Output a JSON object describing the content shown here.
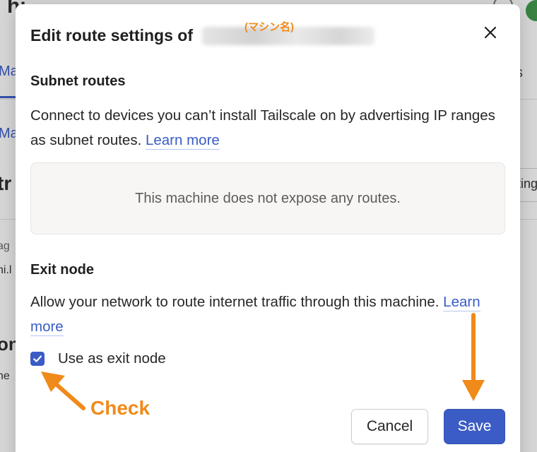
{
  "background": {
    "title_fragment": "hi ... @ ...",
    "tab_left_fragment": "Ma",
    "tab_right_fragment": "s",
    "sub_left_fragment": "Ma",
    "bold_left_fragment": "tr",
    "input_right_fragment": "ting",
    "small1_fragment": "ag",
    "small2_fragment": "hi.l",
    "bold2_fragment": "on",
    "small3_fragment": "ne"
  },
  "modal": {
    "title": "Edit route settings of",
    "machine_name_annotation": "(マシン名)",
    "subnet": {
      "heading": "Subnet routes",
      "description": "Connect to devices you can’t install Tailscale on by advertising IP ranges as subnet routes.",
      "learn_more": "Learn more",
      "empty_state": "This machine does not expose any routes."
    },
    "exit_node": {
      "heading": "Exit node",
      "description": "Allow your network to route internet traffic through this machine.",
      "learn_more": "Learn more",
      "checkbox_label": "Use as exit node",
      "checked": true
    },
    "buttons": {
      "cancel": "Cancel",
      "save": "Save"
    }
  },
  "annotations": {
    "check_label": "Check",
    "accent_color": "#f08a1a"
  },
  "colors": {
    "primary": "#3b5cc4",
    "text": "#262626"
  },
  "icons": {
    "close": "close-icon",
    "check": "checkmark-icon"
  }
}
